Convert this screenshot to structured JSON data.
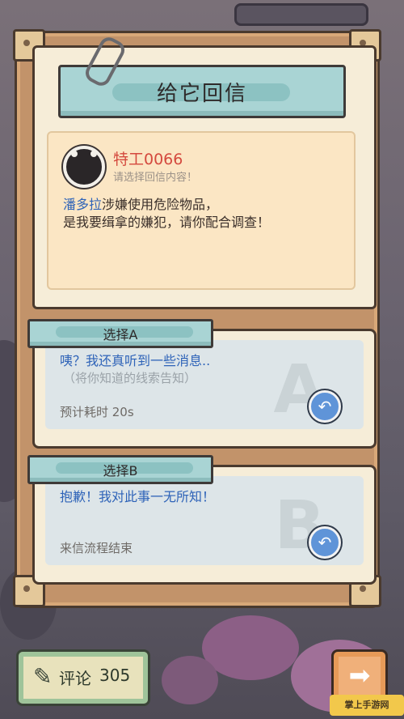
{
  "letter": {
    "title": "给它回信",
    "sender": "特工0066",
    "hint": "请选择回信内容！",
    "message_who": "潘多拉",
    "message_rest": "涉嫌使用危险物品，",
    "message_line2": "是我要缉拿的嫌犯，请你配合调查！"
  },
  "options": [
    {
      "tag": "选择A",
      "line1": "咦？我还真听到一些消息..",
      "line2": "（将你知道的线索告知）",
      "footer": "预计耗时  20s",
      "letter": "A",
      "icon": "reply-icon"
    },
    {
      "tag": "选择B",
      "line1": "抱歉！我对此事一无所知！",
      "footer": "来信流程结束",
      "letter": "B",
      "icon": "reply-icon"
    }
  ],
  "bottom_bar": {
    "comment_label": "评论",
    "comment_count": "305",
    "comment_icon": "quill-icon",
    "next_icon": "arrow-right-icon"
  },
  "watermark": "掌上手游网",
  "colors": {
    "sender": "#d4493e",
    "highlight_blue": "#2e63b8",
    "banner": "#a9d4d4",
    "paper": "#f6edd8",
    "reply_button": "#5f94d8",
    "next_button": "#f0b07a"
  }
}
